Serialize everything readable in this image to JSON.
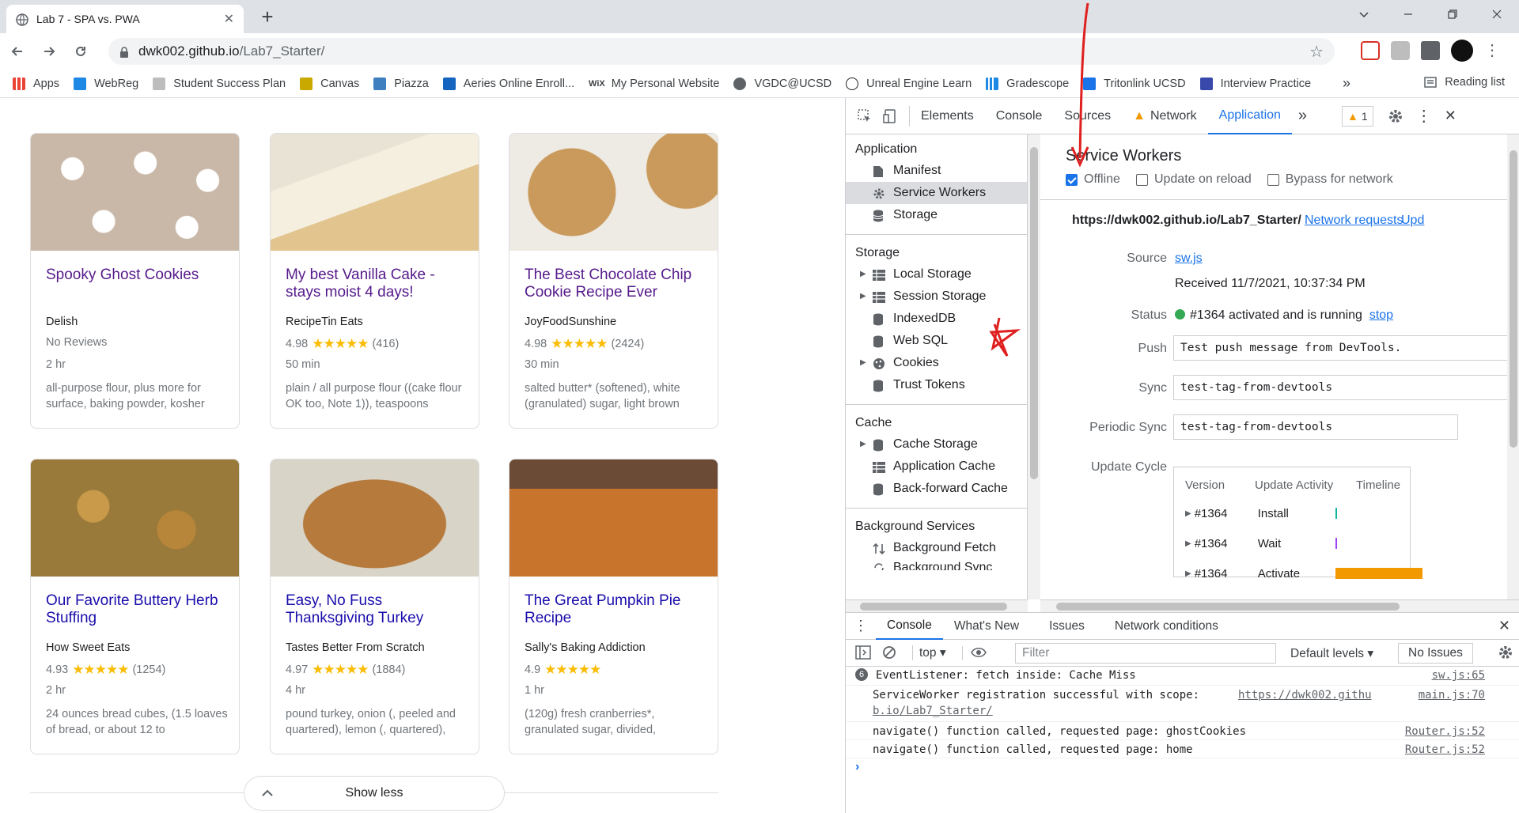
{
  "browser": {
    "tab_title": "Lab 7 - SPA vs. PWA",
    "url_host": "dwk002.github.io",
    "url_path": "/Lab7_Starter/",
    "bookmarks": [
      {
        "label": "Apps",
        "color": "#4285f4"
      },
      {
        "label": "WebReg",
        "color": "#1e88e5"
      },
      {
        "label": "Student Success Plan",
        "color": "#9e9e9e"
      },
      {
        "label": "Canvas",
        "color": "#c9a800"
      },
      {
        "label": "Piazza",
        "color": "#3f7fbf"
      },
      {
        "label": "Aeries Online Enroll...",
        "color": "#1565c0"
      },
      {
        "label": "My Personal Website",
        "color": "#202124"
      },
      {
        "label": "VGDC@UCSD",
        "color": "#5f6368"
      },
      {
        "label": "Unreal Engine Learn",
        "color": "#202124"
      },
      {
        "label": "Gradescope",
        "color": "#1e88e5"
      },
      {
        "label": "Tritonlink UCSD",
        "color": "#1a73e8"
      },
      {
        "label": "Interview Practice",
        "color": "#3949ab"
      }
    ],
    "reading_list": "Reading list",
    "more": "»"
  },
  "recipes": [
    {
      "title": "Spooky Ghost Cookies",
      "org": "Delish",
      "rating": "No Reviews",
      "stars": "",
      "count": "",
      "time": "2 hr",
      "ingredients": "all-purpose flour, plus more for surface, baking powder, kosher",
      "visited": true,
      "img": "#c9b8a8"
    },
    {
      "title": "My best Vanilla Cake - stays moist 4 days!",
      "org": "RecipeTin Eats",
      "rating": "4.98",
      "stars": "★★★★★",
      "count": "(416)",
      "time": "50 min",
      "ingredients": "plain / all purpose flour ((cake flour OK too, Note 1)), teaspoons",
      "visited": true,
      "img": "#e8d9b8"
    },
    {
      "title": "The Best Chocolate Chip Cookie Recipe Ever",
      "org": "JoyFoodSunshine",
      "rating": "4.98",
      "stars": "★★★★★",
      "count": "(2424)",
      "time": "30 min",
      "ingredients": "salted butter* (softened), white (granulated) sugar, light brown",
      "visited": true,
      "img": "#c99a5b"
    },
    {
      "title": "Our Favorite Buttery Herb Stuffing",
      "org": "How Sweet Eats",
      "rating": "4.93",
      "stars": "★★★★★",
      "count": "(1254)",
      "time": "2 hr",
      "ingredients": "24 ounces bread cubes, (1.5 loaves of bread, or about 12 to",
      "visited": false,
      "img": "#9a7a3a"
    },
    {
      "title": "Easy, No Fuss Thanksgiving Turkey",
      "org": "Tastes Better From Scratch",
      "rating": "4.97",
      "stars": "★★★★★",
      "count": "(1884)",
      "time": "4 hr",
      "ingredients": "pound turkey, onion (, peeled and quartered), lemon (, quartered),",
      "visited": false,
      "img": "#b57a3c"
    },
    {
      "title": "The Great Pumpkin Pie Recipe",
      "org": "Sally's Baking Addiction",
      "rating": "4.9",
      "stars": "★★★★★",
      "count": "",
      "time": "1 hr",
      "ingredients": "(120g) fresh cranberries*, granulated sugar, divided,",
      "visited": false,
      "img": "#c8742c"
    }
  ],
  "show_less": "Show less",
  "devtools": {
    "tabs": [
      "Elements",
      "Console",
      "Sources",
      "Network",
      "Application"
    ],
    "active_tab": "Application",
    "more_tabs": "»",
    "warning_count": "1",
    "sidebar": {
      "application_heading": "Application",
      "application_items": [
        "Manifest",
        "Service Workers",
        "Storage"
      ],
      "storage_heading": "Storage",
      "storage_items": [
        "Local Storage",
        "Session Storage",
        "IndexedDB",
        "Web SQL",
        "Cookies",
        "Trust Tokens"
      ],
      "cache_heading": "Cache",
      "cache_items": [
        "Cache Storage",
        "Application Cache",
        "Back-forward Cache"
      ],
      "bg_heading": "Background Services",
      "bg_items": [
        "Background Fetch",
        "Background Sync"
      ]
    },
    "service_workers": {
      "title": "Service Workers",
      "offline_label": "Offline",
      "offline_checked": true,
      "update_on_reload_label": "Update on reload",
      "bypass_label": "Bypass for network",
      "scope": "https://dwk002.github.io/Lab7_Starter/",
      "network_requests": "Network requests",
      "update_link": "Upd",
      "source_label": "Source",
      "source_value": "sw.js",
      "received": "Received 11/7/2021, 10:37:34 PM",
      "status_label": "Status",
      "status_value": "#1364 activated and is running",
      "stop_link": "stop",
      "push_label": "Push",
      "push_value": "Test push message from DevTools.",
      "sync_label": "Sync",
      "sync_value": "test-tag-from-devtools",
      "periodic_label": "Periodic Sync",
      "periodic_value": "test-tag-from-devtools",
      "update_cycle_label": "Update Cycle",
      "uc_headers": [
        "Version",
        "Update Activity",
        "Timeline"
      ],
      "uc_rows": [
        {
          "version": "#1364",
          "activity": "Install",
          "color": "#12b5a0"
        },
        {
          "version": "#1364",
          "activity": "Wait",
          "color": "#a142f4"
        },
        {
          "version": "#1364",
          "activity": "Activate",
          "color": "#f29900"
        }
      ]
    },
    "drawer": {
      "tabs": [
        "Console",
        "What's New",
        "Issues",
        "Network conditions"
      ],
      "context": "top",
      "filter_placeholder": "Filter",
      "levels": "Default levels",
      "no_issues": "No Issues",
      "messages": [
        {
          "count": "6",
          "text": "EventListener: fetch inside: Cache Miss",
          "source": "sw.js:65"
        },
        {
          "count": "",
          "text": "ServiceWorker registration successful with scope:",
          "link": "https://dwk002.githu",
          "link2": "b.io/Lab7_Starter/",
          "source": "main.js:70"
        },
        {
          "count": "",
          "text": "navigate() function called, requested page: ghostCookies",
          "source": "Router.js:52"
        },
        {
          "count": "",
          "text": "navigate() function called, requested page: home",
          "source": "Router.js:52"
        }
      ],
      "prompt": "›"
    }
  },
  "annotations": {
    "arrow_color": "#e02020"
  }
}
